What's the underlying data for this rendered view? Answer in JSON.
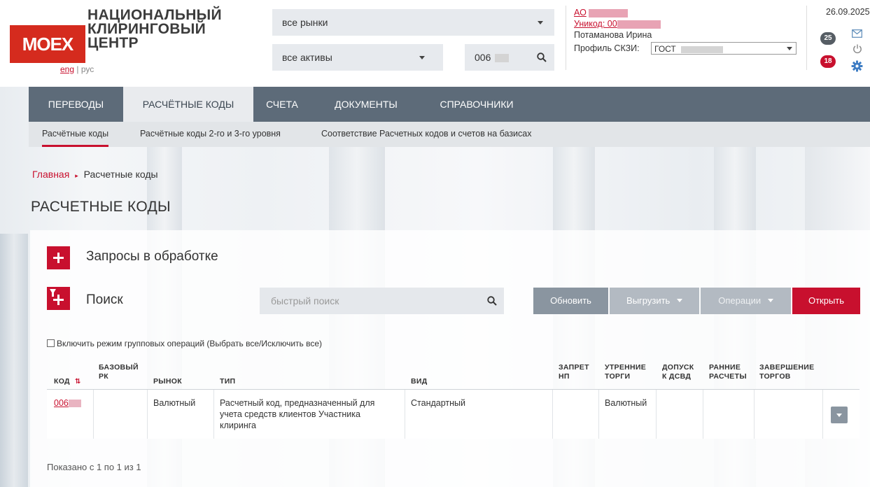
{
  "header": {
    "logo_text": "MOEX",
    "org_lines": [
      "НАЦИОНАЛЬНЫЙ",
      "КЛИРИНГОВЫЙ",
      "ЦЕНТР"
    ],
    "lang_eng": "eng",
    "lang_sep": "|",
    "lang_rus": "рус",
    "market_select": "все рынки",
    "assets_select": "все активы",
    "code_search_value": "006",
    "account_name_prefix": "АО",
    "unicode_prefix": "Уникод: 00",
    "user_name": "Потаманова Ирина",
    "profile_label": "Профиль СКЗИ:",
    "profile_value": "ГОСТ",
    "date": "26.09.2025",
    "badge_messages": "25",
    "badge_alerts": "18"
  },
  "nav": {
    "items": [
      "ПЕРЕВОДЫ",
      "РАСЧЁТНЫЕ КОДЫ",
      "СЧЕТА",
      "ДОКУМЕНТЫ",
      "СПРАВОЧНИКИ"
    ],
    "active": "РАСЧЁТНЫЕ КОДЫ"
  },
  "subnav": {
    "items": [
      "Расчётные коды",
      "Расчётные коды 2-го и 3-го уровня",
      "Соответствие Расчетных кодов и счетов на базисах"
    ],
    "active": "Расчётные коды"
  },
  "breadcrumb": {
    "home": "Главная",
    "separator": "▸",
    "current": "Расчетные коды"
  },
  "page_title": "РАСЧЕТНЫЕ КОДЫ",
  "requests": {
    "label": "Запросы в обработке"
  },
  "search": {
    "label": "Поиск",
    "placeholder": "быстрый поиск",
    "btn_refresh": "Обновить",
    "btn_export": "Выгрузить",
    "btn_operations": "Операции",
    "btn_open": "Открыть"
  },
  "group_ops_label": "Включить режим групповых операций (Выбрать все/Исключить все)",
  "table": {
    "headers": {
      "code": "КОД",
      "base_rk_1": "БАЗОВЫЙ",
      "base_rk_2": "РК",
      "market": "РЫНОК",
      "type": "ТИП",
      "kind": "ВИД",
      "ban_1": "ЗАПРЕТ",
      "ban_2": "НП",
      "morning_1": "УТРЕННИЕ",
      "morning_2": "ТОРГИ",
      "access_1": "ДОПУСК",
      "access_2": "К ДСВД",
      "early_1": "РАННИЕ",
      "early_2": "РАСЧЕТЫ",
      "end_1": "ЗАВЕРШЕНИЕ",
      "end_2": "ТОРГОВ"
    },
    "rows": [
      {
        "code": "006",
        "base_rk": "",
        "market": "Валютный",
        "type_1": "Расчетный код, предназначенный для",
        "type_2": "учета средств клиентов Участника",
        "type_3": "клиринга",
        "kind": "Стандартный",
        "ban": "",
        "morning": "Валютный",
        "access": "",
        "early": "",
        "end": ""
      }
    ]
  },
  "footer": "Показано с 1 по 1 из 1",
  "colors": {
    "brand_red": "#c8102e",
    "nav_bg": "#5d6b79",
    "button_grey": "#8a95a0"
  }
}
